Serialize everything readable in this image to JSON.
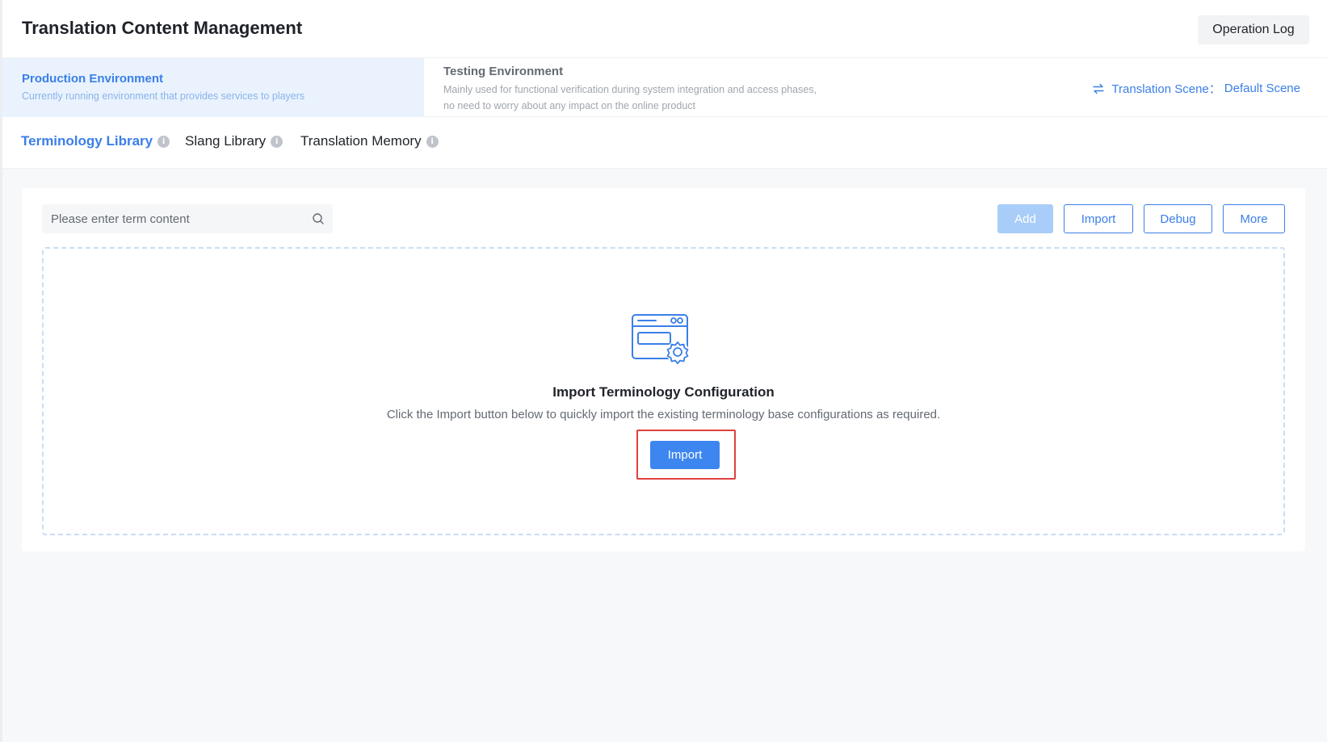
{
  "header": {
    "title": "Translation Content Management",
    "operation_log_label": "Operation Log"
  },
  "environments": {
    "production": {
      "name": "Production Environment",
      "description": "Currently running environment that provides services to players"
    },
    "testing": {
      "name": "Testing Environment",
      "description": "Mainly used for functional verification during system integration and access phases, no need to worry about any impact on the online product"
    },
    "scene": {
      "label": "Translation Scene：",
      "value": "Default Scene",
      "icon": "swap-icon"
    }
  },
  "tabs": [
    {
      "label": "Terminology Library",
      "active": true
    },
    {
      "label": "Slang Library",
      "active": false
    },
    {
      "label": "Translation Memory",
      "active": false
    }
  ],
  "toolbar": {
    "search_placeholder": "Please enter term content",
    "add_label": "Add",
    "import_label": "Import",
    "debug_label": "Debug",
    "more_label": "More"
  },
  "empty_state": {
    "icon": "browser-settings-icon",
    "title": "Import Terminology Configuration",
    "description": "Click the Import button below to quickly import the existing terminology base configurations as required.",
    "import_label": "Import"
  },
  "colors": {
    "accent": "#3a7fe8",
    "active_env_bg": "#e9f2fd",
    "highlight": "#e0403d",
    "primary_button": "#3d86f0",
    "disabled_button": "#a8cdf8"
  }
}
